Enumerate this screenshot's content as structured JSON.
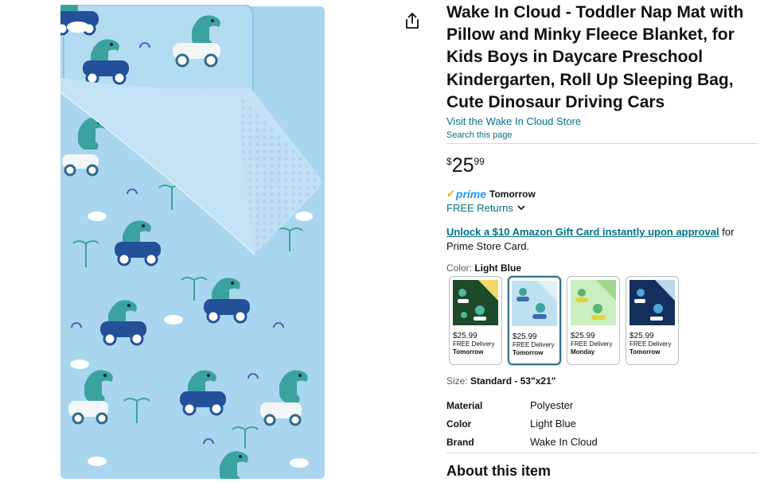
{
  "product": {
    "title": "Wake In Cloud - Toddler Nap Mat with Pillow and Minky Fleece Blanket, for Kids Boys in Daycare Preschool Kindergarten, Roll Up Sleeping Bag, Cute Dinosaur Driving Cars",
    "store_link": "Visit the Wake In Cloud Store",
    "search_page": "Search this page"
  },
  "price": {
    "symbol": "$",
    "whole": "25",
    "fraction": "99"
  },
  "delivery": {
    "prime_label": "prime",
    "prime_day": "Tomorrow",
    "returns_label": "FREE Returns"
  },
  "promo": {
    "link_text": "Unlock a $10 Amazon Gift Card instantly upon approval",
    "suffix": " for Prime Store Card."
  },
  "color": {
    "label": "Color: ",
    "selected": "Light Blue",
    "options": [
      {
        "name": "Dark Green",
        "price": "$25.99",
        "delivery": "FREE Delivery",
        "day": "Tomorrow",
        "bg": "#1d4a2a",
        "accent": "#f2d86a"
      },
      {
        "name": "Light Blue",
        "price": "$25.99",
        "delivery": "FREE Delivery",
        "day": "Tomorrow",
        "bg": "#bfe0f0",
        "accent": "#3c6bb0"
      },
      {
        "name": "Light Green",
        "price": "$25.99",
        "delivery": "FREE Delivery",
        "day": "Monday",
        "bg": "#c9efc0",
        "accent": "#e2d23c"
      },
      {
        "name": "Navy",
        "price": "$25.99",
        "delivery": "FREE Delivery",
        "day": "Tomorrow",
        "bg": "#152f5c",
        "accent": "#4aa7d8"
      }
    ]
  },
  "size": {
    "label": "Size: ",
    "value": "Standard - 53\"x21\""
  },
  "specs": [
    {
      "key": "Material",
      "value": "Polyester"
    },
    {
      "key": "Color",
      "value": "Light Blue"
    },
    {
      "key": "Brand",
      "value": "Wake In Cloud"
    }
  ],
  "about_heading": "About this item",
  "colors": {
    "link": "#007185",
    "prime_blue": "#1a98ff",
    "prime_check": "#f7a300",
    "mat_blue": "#a9d5ee",
    "blanket": "#c3e2f6",
    "dino_teal": "#3aa3a0",
    "car_navy": "#24509a"
  },
  "icons": {
    "share": "share-icon",
    "chevron": "chevron-down-icon"
  }
}
